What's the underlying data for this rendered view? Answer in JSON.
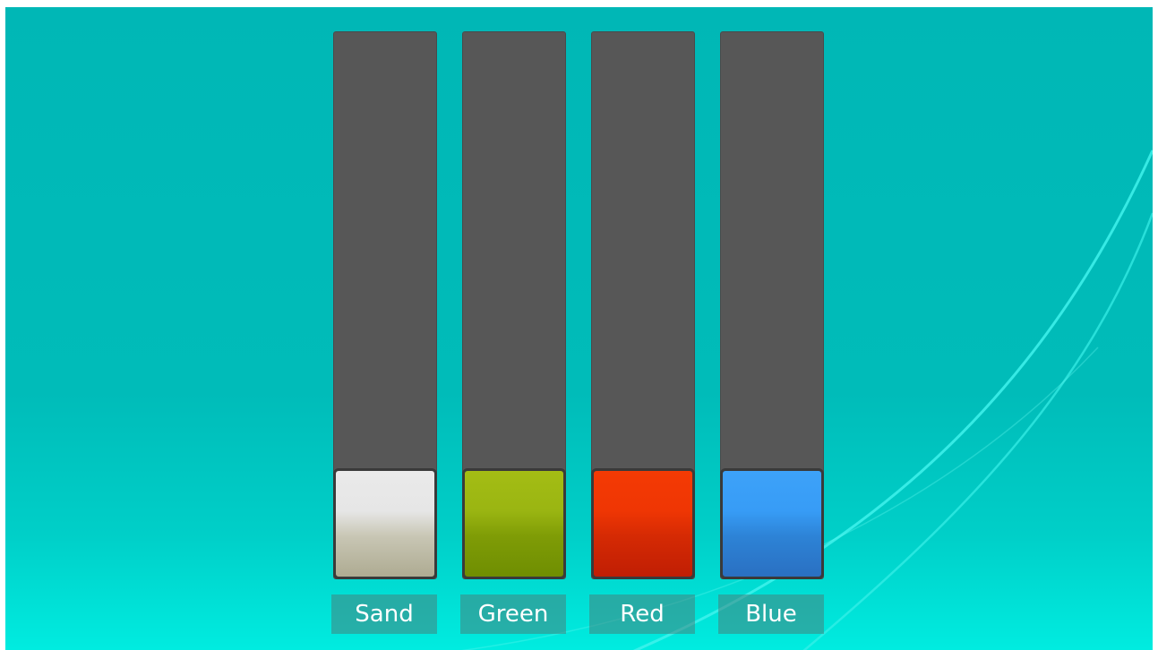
{
  "sliders": [
    {
      "label": "Sand",
      "level": 0,
      "gradient": [
        "#eaeaea",
        "#e6e6e6",
        "#c8c6b4",
        "#aeab92"
      ]
    },
    {
      "label": "Green",
      "level": 0,
      "gradient": [
        "#a4bd14",
        "#9ab512",
        "#7f9c06",
        "#6f8e02"
      ]
    },
    {
      "label": "Red",
      "level": 0,
      "gradient": [
        "#f43a04",
        "#ef3604",
        "#d52a04",
        "#c01e04"
      ]
    },
    {
      "label": "Blue",
      "level": 0,
      "gradient": [
        "#3da2f9",
        "#379cf6",
        "#2d83d6",
        "#2a70c2"
      ]
    }
  ],
  "colors": {
    "background_top": "#00b7b6",
    "background_bottom": "#00ece0",
    "track": "#575757",
    "label_background": "#468277"
  }
}
